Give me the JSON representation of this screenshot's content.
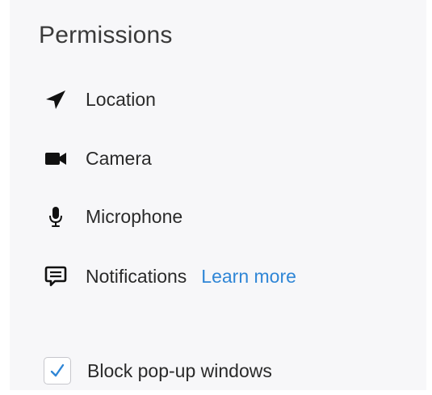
{
  "section": {
    "title": "Permissions"
  },
  "permissions": [
    {
      "label": "Location",
      "icon": "location-arrow-icon"
    },
    {
      "label": "Camera",
      "icon": "camera-icon"
    },
    {
      "label": "Microphone",
      "icon": "microphone-icon"
    },
    {
      "label": "Notifications",
      "icon": "notifications-icon",
      "link": "Learn more"
    }
  ],
  "popups": {
    "label": "Block pop-up windows",
    "checked": true
  },
  "colors": {
    "panel_background": "#f7f7f9",
    "link": "#2f86d6",
    "checkmark": "#2f86d6",
    "icon": "#111111"
  }
}
